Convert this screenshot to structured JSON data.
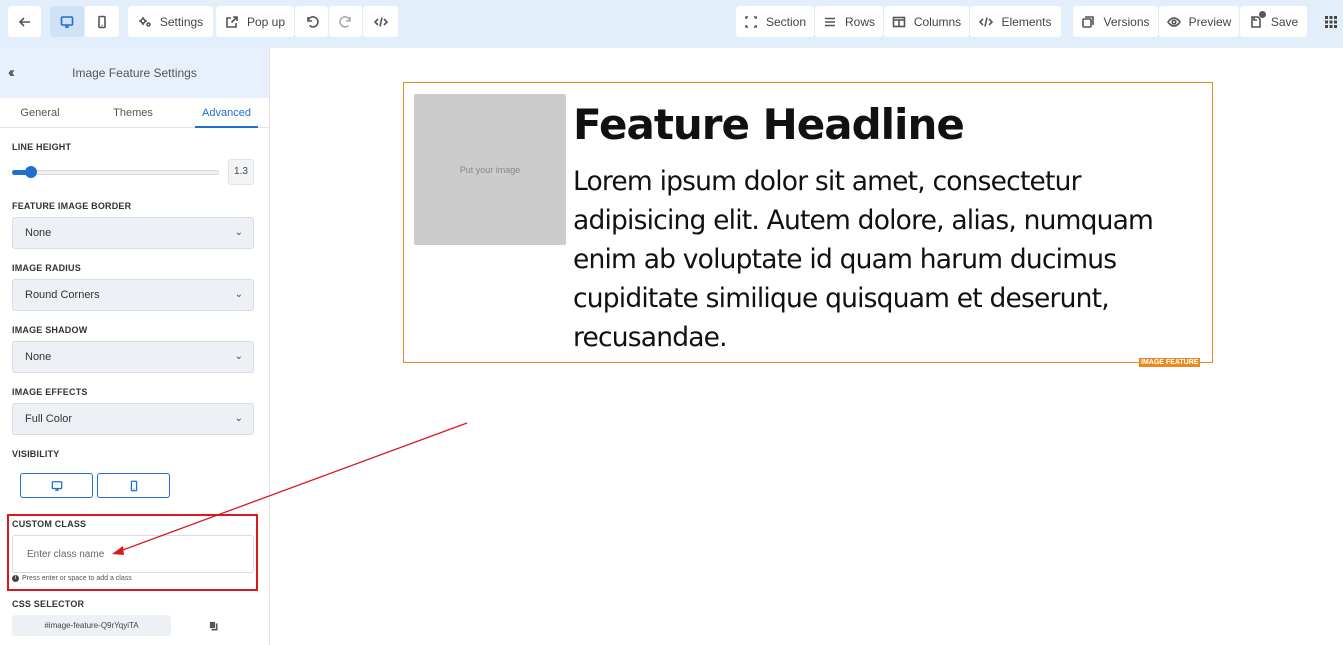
{
  "toolbar": {
    "settings_label": "Settings",
    "popup_label": "Pop up",
    "section_label": "Section",
    "rows_label": "Rows",
    "columns_label": "Columns",
    "elements_label": "Elements",
    "versions_label": "Versions",
    "preview_label": "Preview",
    "save_label": "Save"
  },
  "panel": {
    "title": "Image Feature Settings",
    "tabs": [
      {
        "label": "General"
      },
      {
        "label": "Themes"
      },
      {
        "label": "Advanced"
      }
    ],
    "active_tab": "Advanced",
    "line_height": {
      "label": "LINE HEIGHT",
      "value": "1.3",
      "fraction": 0.09
    },
    "image_border": {
      "label": "FEATURE IMAGE BORDER",
      "value": "None"
    },
    "image_radius": {
      "label": "IMAGE RADIUS",
      "value": "Round Corners"
    },
    "image_shadow": {
      "label": "IMAGE SHADOW",
      "value": "None"
    },
    "image_effects": {
      "label": "IMAGE EFFECTS",
      "value": "Full Color"
    },
    "visibility": {
      "label": "VISIBILITY"
    },
    "custom_class": {
      "label": "CUSTOM CLASS",
      "placeholder": "Enter class name",
      "hint": "Press enter or space to add a class"
    },
    "css_selector": {
      "label": "CSS SELECTOR",
      "value": "#image-feature-Q9rYqyiTA"
    }
  },
  "canvas": {
    "image_placeholder": "Put your image",
    "headline": "Feature Headline",
    "body": "Lorem ipsum dolor sit amet, consectetur adipisicing elit. Autem dolore, alias, numquam enim ab voluptate id quam harum ducimus cupiditate similique quisquam et deserunt, recusandae.",
    "tag": "IMAGE FEATURE"
  },
  "colors": {
    "accent": "#1e6fd0",
    "feature_outline": "#e88a1f",
    "annotation_red": "#d9181f",
    "toolbar_bg": "#e2eef9"
  }
}
